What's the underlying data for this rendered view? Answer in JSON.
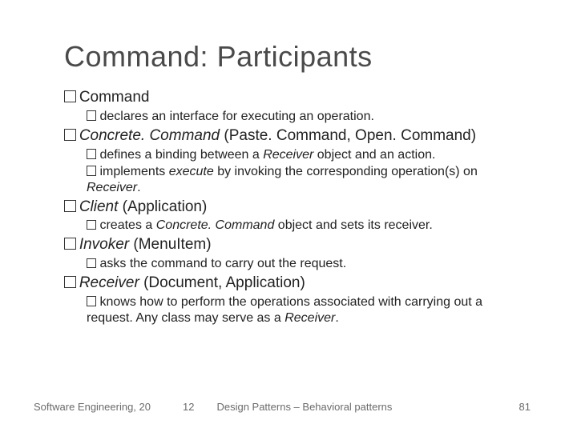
{
  "title": "Command: Participants",
  "items": {
    "command": {
      "head": "Command",
      "sub1_a": "declares an interface for executing an operation."
    },
    "concrete": {
      "head_a": "Concrete. Command",
      "head_b": " (Paste. Command, Open. Command)",
      "sub1_a": "defines a binding between a ",
      "sub1_b": "Receiver",
      "sub1_c": " object and an action.",
      "sub2_a": "implements ",
      "sub2_b": "execute",
      "sub2_c": " by invoking the corresponding operation(s) on ",
      "sub2_d": "Receiver",
      "sub2_e": "."
    },
    "client": {
      "head_a": "Client",
      "head_b": " (Application)",
      "sub1_a": "creates a ",
      "sub1_b": "Concrete. Command",
      "sub1_c": " object and sets its receiver."
    },
    "invoker": {
      "head_a": "Invoker",
      "head_b": " (MenuItem)",
      "sub1_a": "asks the command to carry out the request."
    },
    "receiver": {
      "head_a": "Receiver",
      "head_b": " (Document, Application)",
      "sub1_a": "knows how to perform the operations associated with carrying out a request. Any class may serve as a ",
      "sub1_b": "Receiver",
      "sub1_c": "."
    }
  },
  "footer": {
    "left": "Software Engineering, 20",
    "mid": "12",
    "mid2": "Design Patterns – Behavioral patterns",
    "right": "81"
  }
}
